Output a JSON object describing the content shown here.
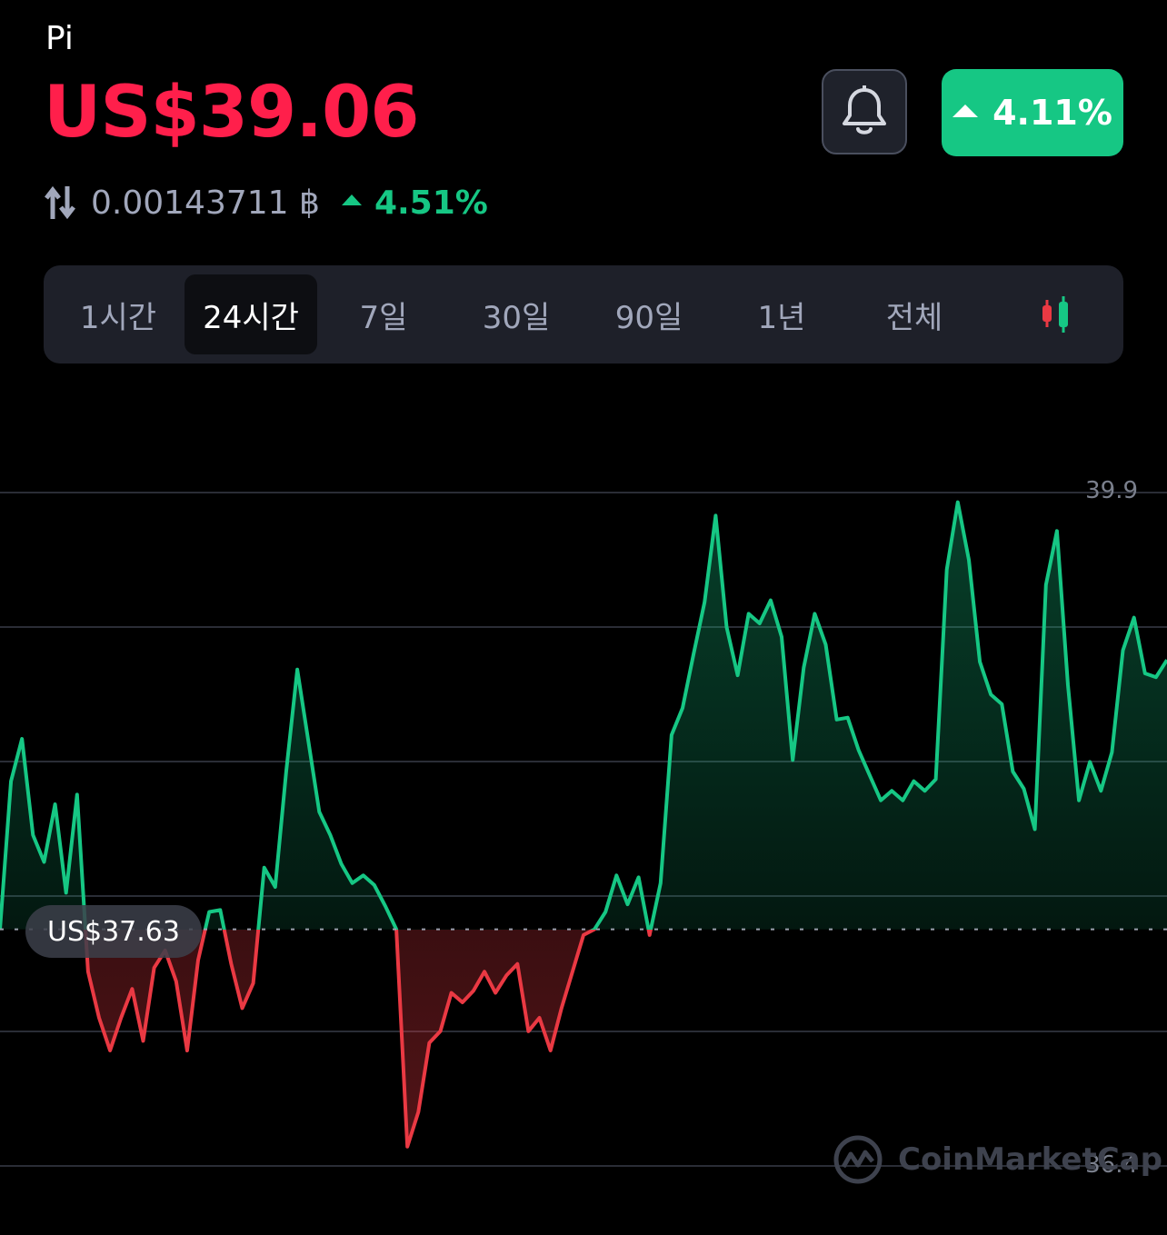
{
  "header": {
    "coin_name": "Pi",
    "price": "US$39.06",
    "btc_price": "0.00143711 ฿",
    "btc_change": "4.51%",
    "change_24h": "4.11%"
  },
  "tabs": [
    {
      "label": "1시간",
      "active": false
    },
    {
      "label": "24시간",
      "active": true
    },
    {
      "label": "7일",
      "active": false
    },
    {
      "label": "30일",
      "active": false
    },
    {
      "label": "90일",
      "active": false
    },
    {
      "label": "1년",
      "active": false
    },
    {
      "label": "전체",
      "active": false
    }
  ],
  "icons": {
    "bell": "bell-icon",
    "swap": "swap-arrows-icon",
    "candlestick": "candlestick-chart-icon",
    "watermark_logo": "coinmarketcap-logo-icon"
  },
  "colors": {
    "up": "#16c784",
    "down": "#ea3943",
    "price": "#ff1f4b",
    "background": "#000000"
  },
  "chart": {
    "baseline_label": "US$37.63",
    "watermark": "CoinMarketCap"
  },
  "chart_data": {
    "type": "area",
    "y_ticks": [
      "39.9",
      "36.4"
    ],
    "ylim": [
      36.4,
      39.9
    ],
    "baseline": 37.63,
    "values": [
      37.63,
      38.4,
      38.62,
      38.12,
      37.98,
      38.28,
      37.82,
      38.33,
      37.41,
      37.17,
      37.0,
      37.17,
      37.32,
      37.05,
      37.43,
      37.52,
      37.36,
      37.0,
      37.47,
      37.72,
      37.73,
      37.45,
      37.22,
      37.35,
      37.95,
      37.85,
      38.45,
      38.98,
      38.61,
      38.24,
      38.12,
      37.97,
      37.87,
      37.91,
      37.86,
      37.75,
      37.63,
      36.5,
      36.68,
      37.04,
      37.1,
      37.3,
      37.25,
      37.31,
      37.41,
      37.3,
      37.39,
      37.45,
      37.1,
      37.17,
      37.0,
      37.22,
      37.41,
      37.6,
      37.63,
      37.72,
      37.91,
      37.76,
      37.9,
      37.6,
      37.87,
      38.64,
      38.78,
      39.06,
      39.33,
      39.78,
      39.2,
      38.95,
      39.27,
      39.22,
      39.34,
      39.15,
      38.51,
      38.99,
      39.27,
      39.11,
      38.72,
      38.73,
      38.56,
      38.43,
      38.3,
      38.35,
      38.3,
      38.4,
      38.35,
      38.41,
      39.5,
      39.85,
      39.55,
      39.02,
      38.85,
      38.8,
      38.45,
      38.36,
      38.15,
      39.42,
      39.7,
      38.9,
      38.3,
      38.5,
      38.35,
      38.55,
      39.08,
      39.25,
      38.96,
      38.94,
      39.03
    ],
    "grid": true,
    "legend": "none"
  }
}
